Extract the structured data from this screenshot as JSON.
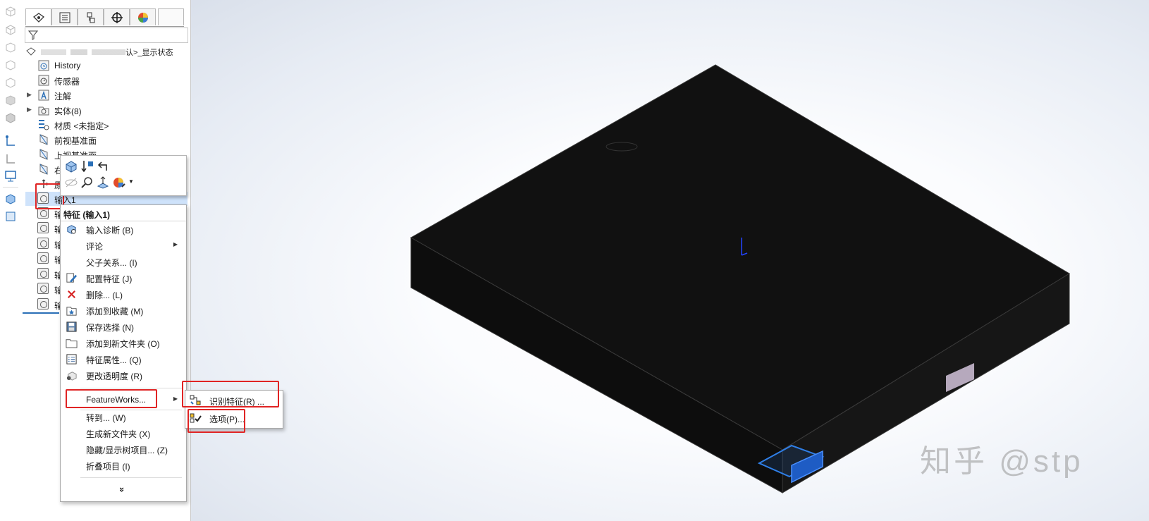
{
  "feature_tree": {
    "root_label": "认>_显示状态",
    "items": [
      {
        "label": "History",
        "icon": "history-icon"
      },
      {
        "label": "传感器",
        "icon": "sensor-icon"
      },
      {
        "label": "注解",
        "icon": "annotation-icon",
        "expandable": true
      },
      {
        "label": "实体(8)",
        "icon": "solid-bodies-icon",
        "expandable": true
      },
      {
        "label": "材质 <未指定>",
        "icon": "material-icon"
      },
      {
        "label": "前视基准面",
        "icon": "plane-icon"
      },
      {
        "label": "上视基准面",
        "icon": "plane-icon"
      },
      {
        "label": "右",
        "icon": "plane-icon"
      },
      {
        "label": "原",
        "icon": "origin-icon"
      },
      {
        "label": "输入1",
        "icon": "import-feature-icon"
      },
      {
        "label": "输",
        "icon": "import-feature-icon"
      },
      {
        "label": "输",
        "icon": "import-feature-icon"
      },
      {
        "label": "输",
        "icon": "import-feature-icon"
      },
      {
        "label": "输",
        "icon": "import-feature-icon"
      },
      {
        "label": "输",
        "icon": "import-feature-icon"
      },
      {
        "label": "输",
        "icon": "import-feature-icon"
      },
      {
        "label": "输",
        "icon": "import-feature-icon"
      }
    ]
  },
  "tabs": [
    "feature-manager",
    "property-manager",
    "configuration-manager",
    "dimxpert-manager",
    "display-manager"
  ],
  "context_menu": {
    "header": "特征 (输入1)",
    "items": [
      {
        "label": "输入诊断 (B)",
        "icon": "import-diagnostics-icon"
      },
      {
        "label": "评论",
        "submenu": true
      },
      {
        "label": "父子关系... (I)"
      },
      {
        "label": "配置特征 (J)",
        "icon": "configure-feature-icon"
      },
      {
        "label": "删除... (L)",
        "icon": "delete-icon"
      },
      {
        "label": "添加到收藏 (M)",
        "icon": "favorite-icon"
      },
      {
        "label": "保存选择 (N)",
        "icon": "save-selection-icon"
      },
      {
        "label": "添加到新文件夹 (O)",
        "icon": "folder-icon"
      },
      {
        "label": "特征属性... (Q)",
        "icon": "properties-icon"
      },
      {
        "label": "更改透明度 (R)",
        "icon": "transparency-icon"
      },
      {
        "label": "FeatureWorks...",
        "submenu": true
      },
      {
        "label": "转到... (W)"
      },
      {
        "label": "生成新文件夹 (X)"
      },
      {
        "label": "隐藏/显示树项目... (Z)"
      },
      {
        "label": "折叠项目 (I)"
      }
    ],
    "expand_more": "»"
  },
  "submenu": {
    "items": [
      {
        "label": "识别特征(R) ...",
        "icon": "recognize-features-icon"
      },
      {
        "label": "选项(P)...",
        "icon": "options-icon"
      }
    ]
  },
  "watermark": "知乎 @stp",
  "colors": {
    "highlight_box": "#e02424",
    "model_body": "#141414",
    "selected_face": "#2f7fe8"
  }
}
